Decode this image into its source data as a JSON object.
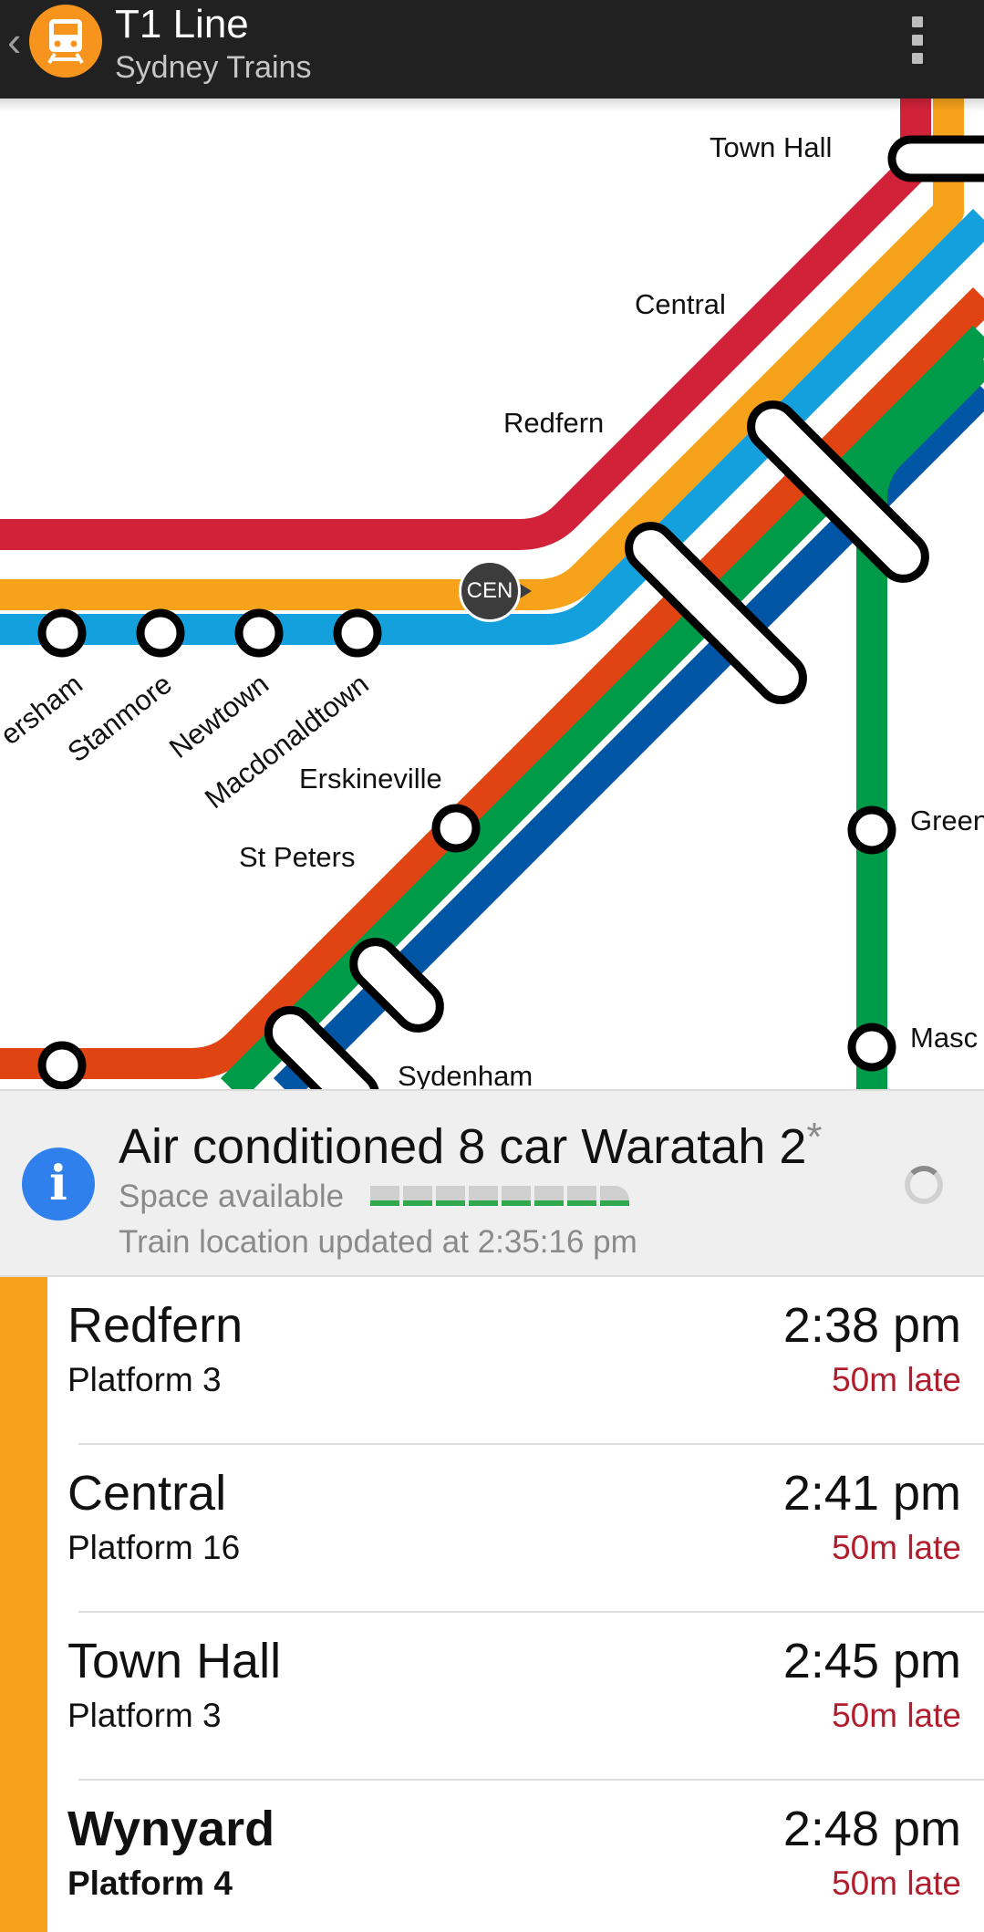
{
  "app_bar": {
    "title": "T1 Line",
    "subtitle": "Sydney Trains",
    "back_glyph": "‹",
    "app_icon": "train-icon",
    "menu_icon": "overflow-menu-icon"
  },
  "map": {
    "line_colors": {
      "red": "#d2223a",
      "orange": "#f7a21b",
      "light_blue": "#14a0dc",
      "red_orange": "#e04412",
      "green": "#009b48",
      "dark_blue": "#0055a5"
    },
    "current_position_badge": "CEN",
    "stations": {
      "town_hall": "Town Hall",
      "central": "Central",
      "redfern": "Redfern",
      "petersham": "ersham",
      "stanmore": "Stanmore",
      "newtown": "Newtown",
      "macdonaldtown": "Macdonaldtown",
      "erskineville": "Erskineville",
      "st_peters": "St Peters",
      "sydenham": "Sydenham",
      "green_square": "Green",
      "mascot": "Masc"
    }
  },
  "train_info": {
    "title": "Air conditioned 8 car Waratah 2",
    "asterisk": "*",
    "space_label": "Space available",
    "capacity_cars": 8,
    "capacity_color": "#2ea84b",
    "updated": "Train location updated at 2:35:16 pm"
  },
  "stops": [
    {
      "name": "Redfern",
      "platform": "Platform 3",
      "time": "2:38 pm",
      "status": "50m late"
    },
    {
      "name": "Central",
      "platform": "Platform 16",
      "time": "2:41 pm",
      "status": "50m late"
    },
    {
      "name": "Town Hall",
      "platform": "Platform 3",
      "time": "2:45 pm",
      "status": "50m late"
    },
    {
      "name": "Wynyard",
      "platform": "Platform 4",
      "time": "2:48 pm",
      "status": "50m late"
    }
  ],
  "colors": {
    "line_accent": "#f7a21b",
    "late_text": "#b01e2e",
    "info_blue": "#2f80ed"
  }
}
